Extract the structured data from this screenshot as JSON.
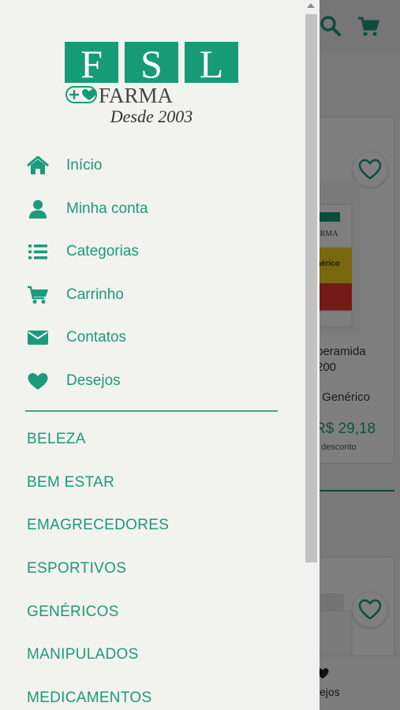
{
  "colors": {
    "accent": "#1b9a7c",
    "logo_green": "#169b76",
    "price": "#1fa37f"
  },
  "logo": {
    "letters": [
      "F",
      "S",
      "L"
    ],
    "word": "FARMA",
    "tagline": "Desde 2003"
  },
  "menu": [
    {
      "label": "Início",
      "icon": "home-icon"
    },
    {
      "label": "Minha conta",
      "icon": "user-icon"
    },
    {
      "label": "Categorias",
      "icon": "list-icon"
    },
    {
      "label": "Carrinho",
      "icon": "cart-icon"
    },
    {
      "label": "Contatos",
      "icon": "envelope-icon"
    },
    {
      "label": "Desejos",
      "icon": "heart-icon"
    }
  ],
  "categories": [
    "BELEZA",
    "BEM ESTAR",
    "EMAGRECEDORES",
    "ESPORTIVOS",
    "GENÉRICOS",
    "MANIPULADOS",
    "MEDICAMENTOS"
  ],
  "background": {
    "product": {
      "name_line1": "peramida",
      "name_line2": "200",
      "type": "- Genérico",
      "price": "R$ 29,18",
      "discount": "desconto",
      "box_brand": "FARMA",
      "box_label": "enérico"
    },
    "bottom_nav_label": "ejos"
  }
}
